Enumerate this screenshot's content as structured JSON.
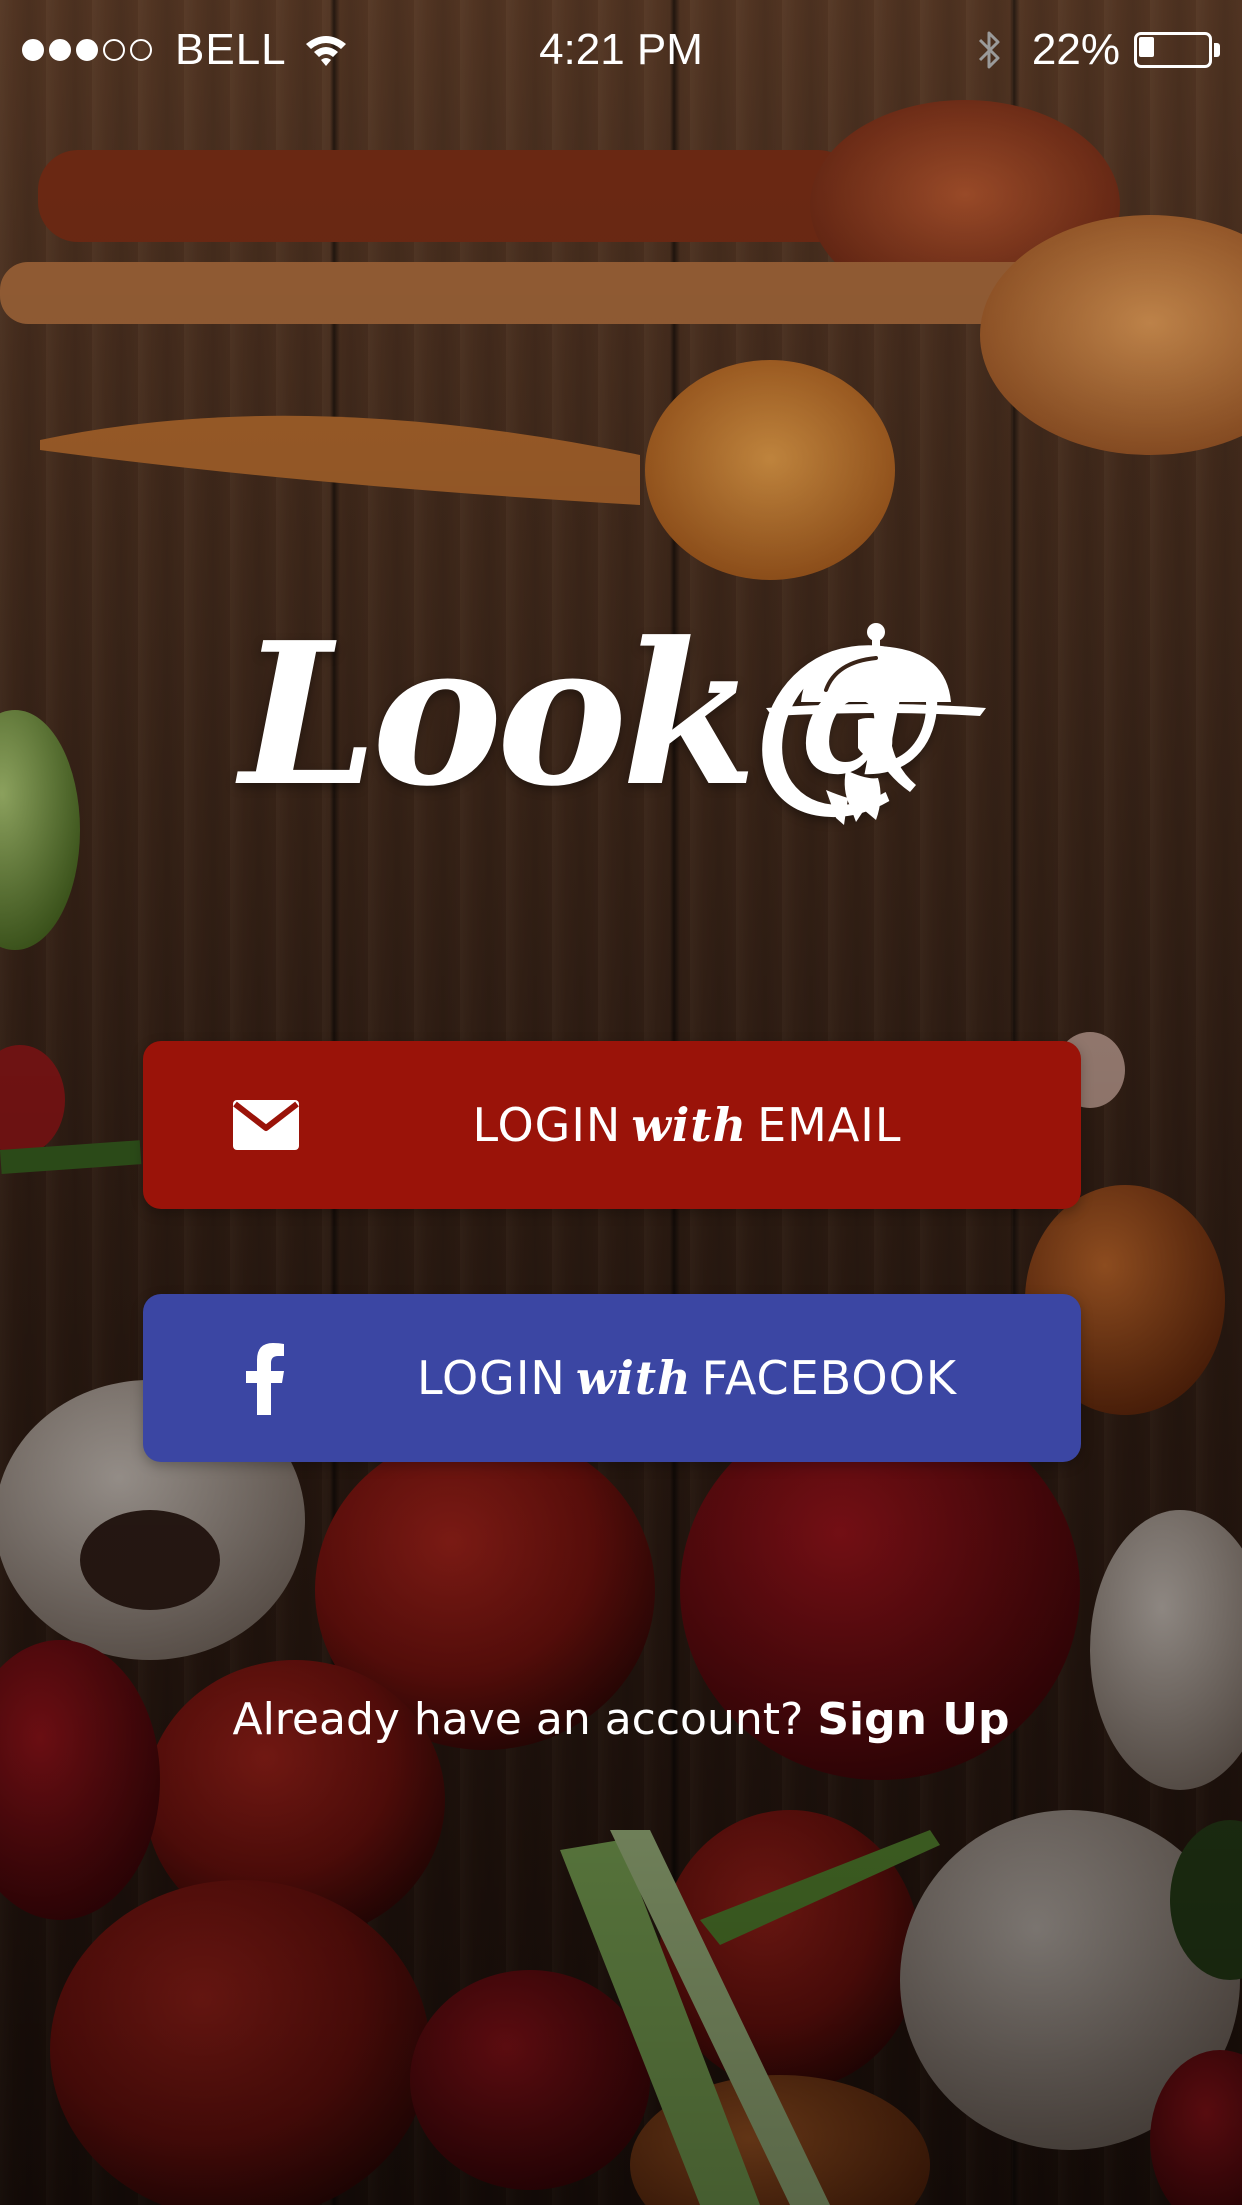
{
  "status_bar": {
    "signal_total": 5,
    "signal_filled": 3,
    "carrier": "BELL",
    "time": "4:21 PM",
    "battery_percent": "22%",
    "battery_level": 0.22
  },
  "logo": {
    "text": "Look@",
    "icon": "cloche-waiter-icon"
  },
  "buttons": {
    "email": {
      "prefix": "LOGIN",
      "middle": "with",
      "suffix": "EMAIL",
      "icon": "mail-icon",
      "color": "#9a1309"
    },
    "facebook": {
      "prefix": "LOGIN",
      "middle": "with",
      "suffix": "FACEBOOK",
      "icon": "facebook-icon",
      "color": "#3b46a3"
    }
  },
  "signup": {
    "prompt": "Already have an account?",
    "link": "Sign Up"
  }
}
